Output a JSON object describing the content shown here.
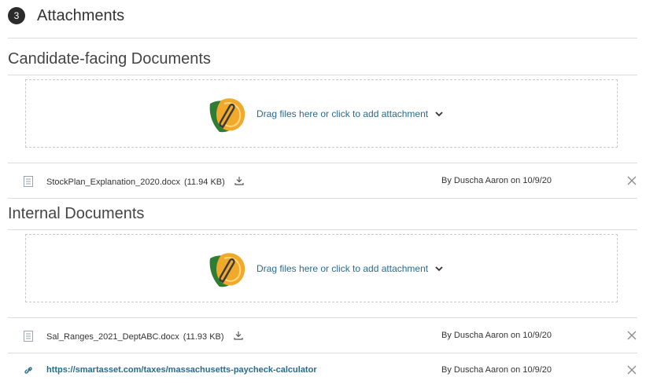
{
  "step": {
    "number": "3",
    "title": "Attachments"
  },
  "sections": [
    {
      "title": "Candidate-facing Documents",
      "dropzone_text": "Drag files here or click to add attachment",
      "files": [
        {
          "name": "StockPlan_Explanation_2020.docx",
          "size": "(11.94 KB)",
          "byline": "By Duscha Aaron on 10/9/20"
        }
      ]
    },
    {
      "title": "Internal Documents",
      "dropzone_text": "Drag files here or click to add attachment",
      "files": [
        {
          "name": "Sal_Ranges_2021_DeptABC.docx",
          "size": "(11.93 KB)",
          "byline": "By Duscha Aaron on 10/9/20"
        }
      ],
      "links": [
        {
          "url": "https://smartasset.com/taxes/massachusetts-paycheck-calculator",
          "byline": "By Duscha Aaron on 10/9/20"
        }
      ]
    }
  ],
  "colors": {
    "link": "#2a6a8a",
    "badge": "#2b2b2b",
    "divider": "#dcdcdc"
  }
}
